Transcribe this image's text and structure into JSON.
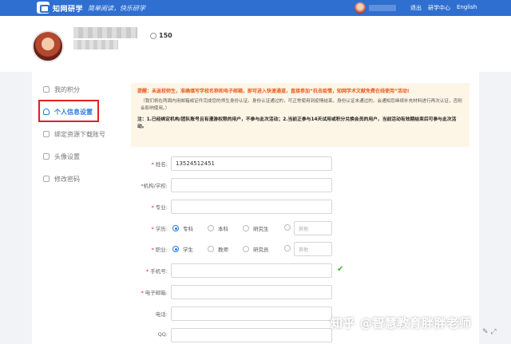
{
  "header": {
    "brand": "知网研学",
    "slogan": "简单阅读，快乐研学",
    "links": [
      "退出",
      "研学中心",
      "English"
    ]
  },
  "profile": {
    "score": "150"
  },
  "sidebar": {
    "items": [
      {
        "label": "我的积分"
      },
      {
        "label": "个人信息设置"
      },
      {
        "label": "绑定资源下载账号"
      },
      {
        "label": "头像设置"
      },
      {
        "label": "修改密码"
      }
    ]
  },
  "notice": {
    "red": "提醒：未返校师生，准确填写学校名称和电子邮箱，即可进入快速通道，直接参加“抗击疫情，知网学术文献免费在线使用”活动!",
    "gray": "（我们将在两周内用邮箱或证件完成您的师生身份认证。身份认证通过的，可正常使用到疫情结束，身份认证未通过的，会通知您继续补充材料进行再次认证，否则会影响使用。）",
    "black": "注：1.已经绑定机构/团队账号且有漫游权限的用户，不参与此次活动；2.当前正参与14天试用或积分兑换会员的用户，当前活动有效期结束后可参与此次活动。"
  },
  "form": {
    "name": {
      "label": "姓名:",
      "value": "13524512451"
    },
    "institution": {
      "label": "*机构/学校:"
    },
    "major": {
      "label": "专业:"
    },
    "education": {
      "label": "学历:",
      "options": [
        "专科",
        "本科",
        "研究生"
      ],
      "selected": "专科",
      "other_placeholder": "其他"
    },
    "occupation": {
      "label": "职业:",
      "options": [
        "学生",
        "教师",
        "研究员"
      ],
      "selected": "学生",
      "other_placeholder": "其他"
    },
    "phone": {
      "label": "手机号:"
    },
    "email": {
      "label": "电子邮箱:"
    },
    "tel": {
      "label": "电话:"
    },
    "qq": {
      "label": "QQ:"
    }
  },
  "watermark": "知乎 @智慧教育胖胖老师",
  "colors": {
    "topbar": "#2f6fd0",
    "accent": "#2a7be4",
    "warning": "#e85a1e",
    "highlight_box": "#e02020"
  }
}
